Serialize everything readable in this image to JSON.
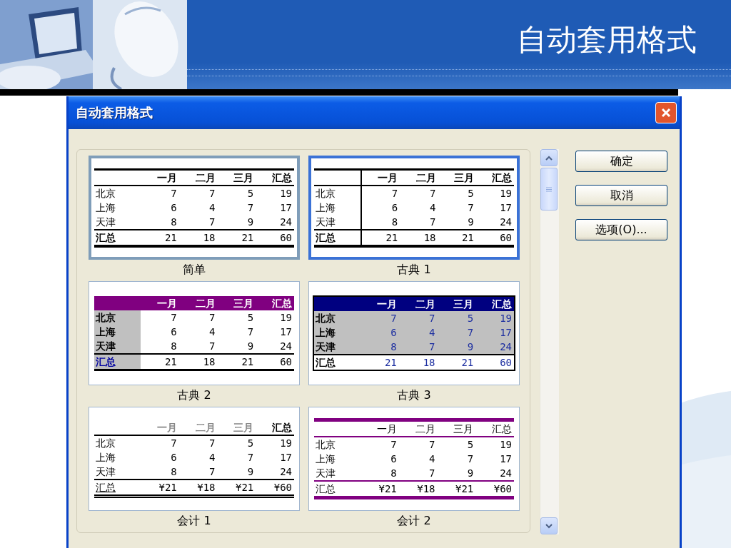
{
  "slide": {
    "title": "自动套用格式"
  },
  "dialog": {
    "title": "自动套用格式",
    "formats": [
      {
        "name": "简单",
        "kind": "simple",
        "selected": false,
        "focused": true,
        "columns": [
          "一月",
          "二月",
          "三月",
          "汇总"
        ],
        "rows": [
          {
            "label": "北京",
            "cells": [
              "7",
              "7",
              "5",
              "19"
            ]
          },
          {
            "label": "上海",
            "cells": [
              "6",
              "4",
              "7",
              "17"
            ]
          },
          {
            "label": "天津",
            "cells": [
              "8",
              "7",
              "9",
              "24"
            ]
          },
          {
            "label": "汇总",
            "cells": [
              "21",
              "18",
              "21",
              "60"
            ]
          }
        ]
      },
      {
        "name": "古典 1",
        "kind": "classic1",
        "selected": true,
        "focused": false,
        "columns": [
          "一月",
          "二月",
          "三月",
          "汇总"
        ],
        "rows": [
          {
            "label": "北京",
            "cells": [
              "7",
              "7",
              "5",
              "19"
            ]
          },
          {
            "label": "上海",
            "cells": [
              "6",
              "4",
              "7",
              "17"
            ]
          },
          {
            "label": "天津",
            "cells": [
              "8",
              "7",
              "9",
              "24"
            ]
          },
          {
            "label": "汇总",
            "cells": [
              "21",
              "18",
              "21",
              "60"
            ]
          }
        ]
      },
      {
        "name": "古典 2",
        "kind": "classic2",
        "selected": false,
        "focused": false,
        "columns": [
          "一月",
          "二月",
          "三月",
          "汇总"
        ],
        "rows": [
          {
            "label": "北京",
            "cells": [
              "7",
              "7",
              "5",
              "19"
            ]
          },
          {
            "label": "上海",
            "cells": [
              "6",
              "4",
              "7",
              "17"
            ]
          },
          {
            "label": "天津",
            "cells": [
              "8",
              "7",
              "9",
              "24"
            ]
          },
          {
            "label": "汇总",
            "cells": [
              "21",
              "18",
              "21",
              "60"
            ]
          }
        ]
      },
      {
        "name": "古典 3",
        "kind": "classic3",
        "selected": false,
        "focused": false,
        "columns": [
          "一月",
          "二月",
          "三月",
          "汇总"
        ],
        "rows": [
          {
            "label": "北京",
            "cells": [
              "7",
              "7",
              "5",
              "19"
            ]
          },
          {
            "label": "上海",
            "cells": [
              "6",
              "4",
              "7",
              "17"
            ]
          },
          {
            "label": "天津",
            "cells": [
              "8",
              "7",
              "9",
              "24"
            ]
          },
          {
            "label": "汇总",
            "cells": [
              "21",
              "18",
              "21",
              "60"
            ]
          }
        ]
      },
      {
        "name": "会计 1",
        "kind": "accounting1",
        "selected": false,
        "focused": false,
        "columns": [
          "一月",
          "二月",
          "三月",
          "汇总"
        ],
        "rows": [
          {
            "label": "北京",
            "cells": [
              "7",
              "7",
              "5",
              "19"
            ]
          },
          {
            "label": "上海",
            "cells": [
              "6",
              "4",
              "7",
              "17"
            ]
          },
          {
            "label": "天津",
            "cells": [
              "8",
              "7",
              "9",
              "24"
            ]
          },
          {
            "label": "汇总",
            "cells": [
              "¥21",
              "¥18",
              "¥21",
              "¥60"
            ]
          }
        ]
      },
      {
        "name": "会计 2",
        "kind": "accounting2",
        "selected": false,
        "focused": false,
        "columns": [
          "一月",
          "二月",
          "三月",
          "汇总"
        ],
        "rows": [
          {
            "label": "北京",
            "cells": [
              "7",
              "7",
              "5",
              "19"
            ]
          },
          {
            "label": "上海",
            "cells": [
              "6",
              "4",
              "7",
              "17"
            ]
          },
          {
            "label": "天津",
            "cells": [
              "8",
              "7",
              "9",
              "24"
            ]
          },
          {
            "label": "汇总",
            "cells": [
              "¥21",
              "¥18",
              "¥21",
              "¥60"
            ]
          }
        ]
      }
    ],
    "buttons": [
      "确定",
      "取消",
      "选项(O)..."
    ]
  }
}
